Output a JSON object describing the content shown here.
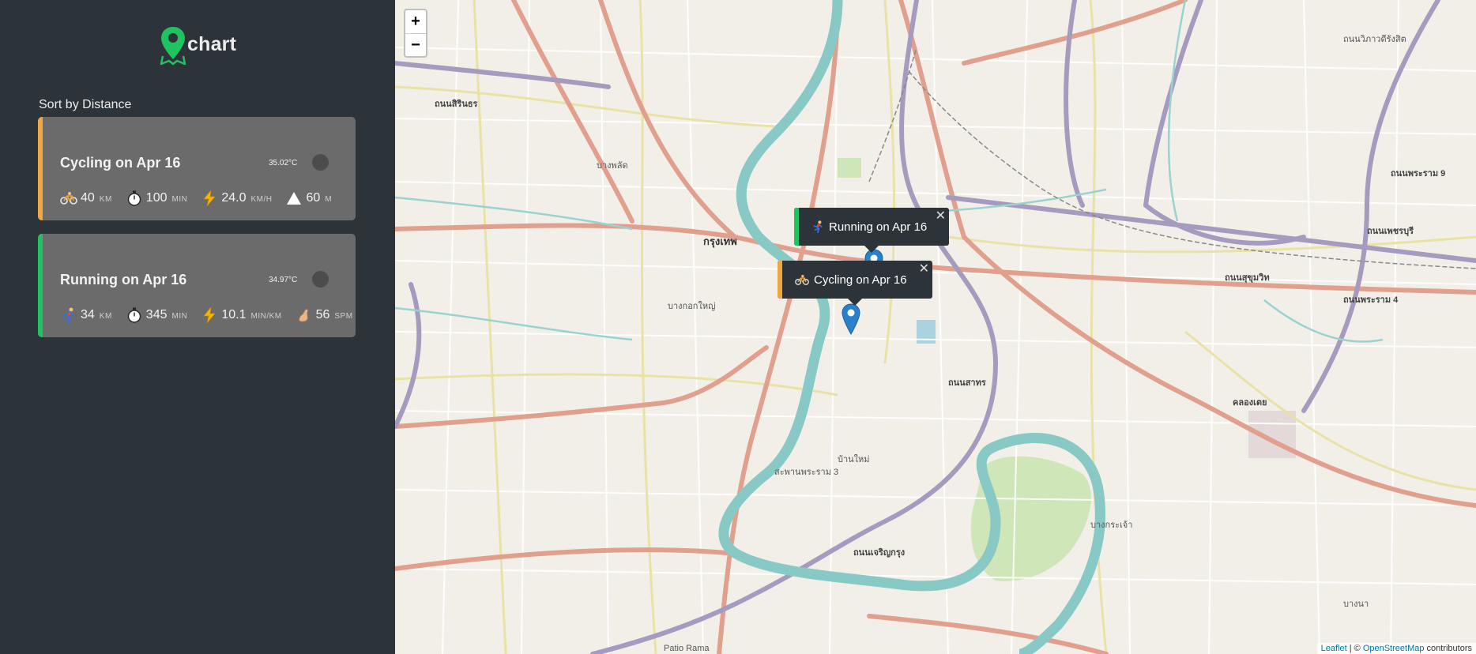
{
  "app": {
    "logo_text": "chart"
  },
  "sidebar": {
    "sort_label": "Sort by Distance",
    "workouts": [
      {
        "title": "Cycling on Apr 16",
        "temp": "35.02°C",
        "accent": "#f0a742",
        "stats": [
          {
            "icon": "bicycle-icon",
            "value": "40",
            "unit": "KM"
          },
          {
            "icon": "stopwatch-icon",
            "value": "100",
            "unit": "MIN"
          },
          {
            "icon": "lightning-icon",
            "value": "24.0",
            "unit": "KM/H"
          },
          {
            "icon": "mountain-icon",
            "value": "60",
            "unit": "M"
          }
        ]
      },
      {
        "title": "Running on Apr 16",
        "temp": "34.97°C",
        "accent": "#1fc35f",
        "stats": [
          {
            "icon": "runner-icon",
            "value": "34",
            "unit": "KM"
          },
          {
            "icon": "stopwatch-icon",
            "value": "345",
            "unit": "MIN"
          },
          {
            "icon": "lightning-icon",
            "value": "10.1",
            "unit": "MIN/KM"
          },
          {
            "icon": "footprint-icon",
            "value": "56",
            "unit": "SPM"
          }
        ]
      }
    ]
  },
  "map": {
    "zoom_in": "+",
    "zoom_out": "−",
    "popups": [
      {
        "label": "Running on Apr 16",
        "icon": "runner-icon",
        "accent": "#1fc35f",
        "close": "✕"
      },
      {
        "label": "Cycling on Apr 16",
        "icon": "bicycle-icon",
        "accent": "#f0a742",
        "close": "✕"
      }
    ],
    "attribution": {
      "leaflet": "Leaflet",
      "sep": " | © ",
      "osm": "OpenStreetMap",
      "rest": " contributors"
    },
    "marker_color": "#2a81cb",
    "place_labels": [
      "ถนนสิรินธร",
      "บางพลัด",
      "กรุงเทพ",
      "บางกอกใหญ่",
      "ถนนเพชรบุรี",
      "ถนนสุขุมวิท",
      "สะพานพระราม 3",
      "ถนนสาทร",
      "บ้านใหม่",
      "ถนนวิภาวดีรังสิต",
      "ถนนพระราม 4",
      "คลองเตย",
      "บางกระเจ้า",
      "ถนนพระราม 9",
      "ถนนเจริญกรุง",
      "บางนา",
      "Patio Rama"
    ]
  }
}
